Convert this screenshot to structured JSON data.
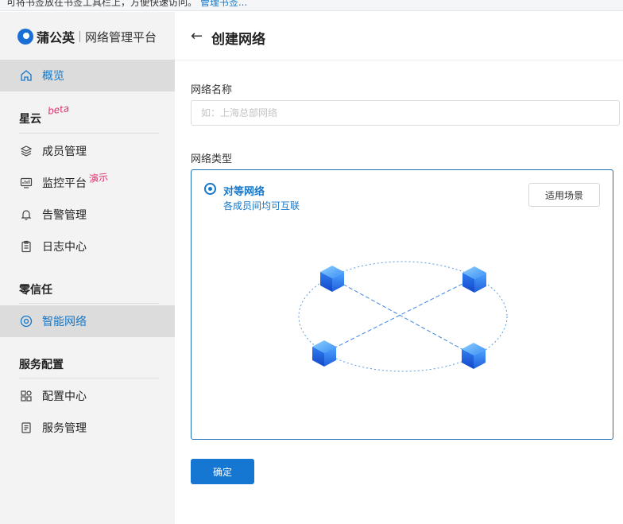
{
  "notice": {
    "text": "可将书签放在书签工具栏上，方便快速访问。",
    "link": "管理书签..."
  },
  "brand": {
    "name": "蒲公英",
    "subtitle": "网络管理平台"
  },
  "sidebar": {
    "overview": "概览",
    "groups": [
      {
        "title": "星云",
        "tag": "beta",
        "items": [
          {
            "label": "成员管理",
            "icon": "layers-icon"
          },
          {
            "label": "监控平台",
            "icon": "monitor-icon",
            "tag": "演示"
          },
          {
            "label": "告警管理",
            "icon": "bell-icon"
          },
          {
            "label": "日志中心",
            "icon": "clipboard-icon"
          }
        ]
      },
      {
        "title": "零信任",
        "items": [
          {
            "label": "智能网络",
            "icon": "network-icon",
            "active": true
          }
        ]
      },
      {
        "title": "服务配置",
        "items": [
          {
            "label": "配置中心",
            "icon": "grid-icon"
          },
          {
            "label": "服务管理",
            "icon": "document-icon"
          }
        ]
      }
    ]
  },
  "header": {
    "back_icon": "arrow-left-icon",
    "title": "创建网络"
  },
  "form": {
    "name_label": "网络名称",
    "name_placeholder": "如：上海总部网络",
    "name_value": "",
    "type_label": "网络类型",
    "type_option": {
      "title": "对等网络",
      "desc": "各成员间均可互联",
      "selected": true
    },
    "scene_button": "适用场景",
    "confirm_button": "确定"
  },
  "colors": {
    "accent": "#1677c8",
    "tag_pink": "#e0306a",
    "sidebar_bg": "#f3f3f3",
    "active_bg": "#dcdcdc"
  }
}
